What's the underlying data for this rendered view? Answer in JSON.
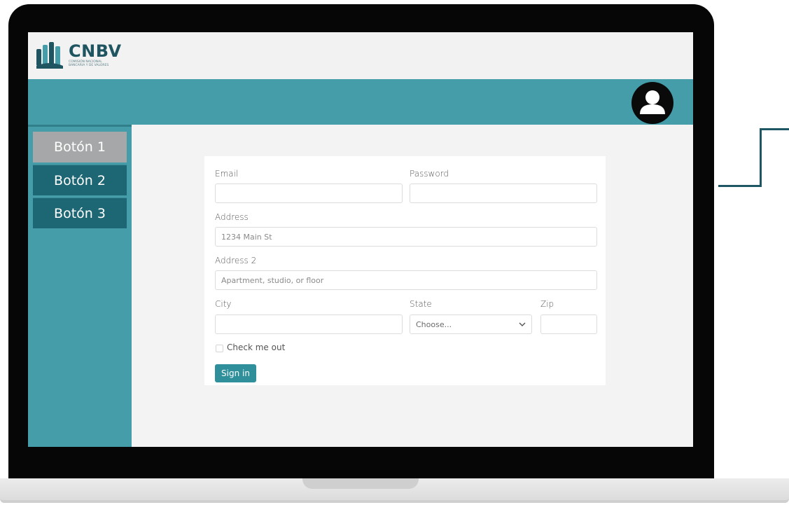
{
  "brand": {
    "name": "CNBV",
    "subtitle_line1": "COMISIÓN NACIONAL",
    "subtitle_line2": "BANCARIA Y DE VALORES",
    "primary_color": "#449da9",
    "dark_color": "#1d6775"
  },
  "header": {
    "avatar_icon": "user-circle-icon"
  },
  "sidebar": {
    "items": [
      {
        "label": "Botón 1",
        "active": true
      },
      {
        "label": "Botón 2",
        "active": false
      },
      {
        "label": "Botón 3",
        "active": false
      }
    ]
  },
  "form": {
    "email": {
      "label": "Email",
      "value": "",
      "placeholder": ""
    },
    "password": {
      "label": "Password",
      "value": "",
      "placeholder": ""
    },
    "address": {
      "label": "Address",
      "placeholder": "1234 Main St"
    },
    "address2": {
      "label": "Address 2",
      "placeholder": "Apartment, studio, or floor"
    },
    "city": {
      "label": "City",
      "value": ""
    },
    "state": {
      "label": "State",
      "selected": "Choose..."
    },
    "zip": {
      "label": "Zip",
      "value": ""
    },
    "checkbox": {
      "label": "Check me out",
      "checked": false
    },
    "submit_label": "Sign in"
  }
}
